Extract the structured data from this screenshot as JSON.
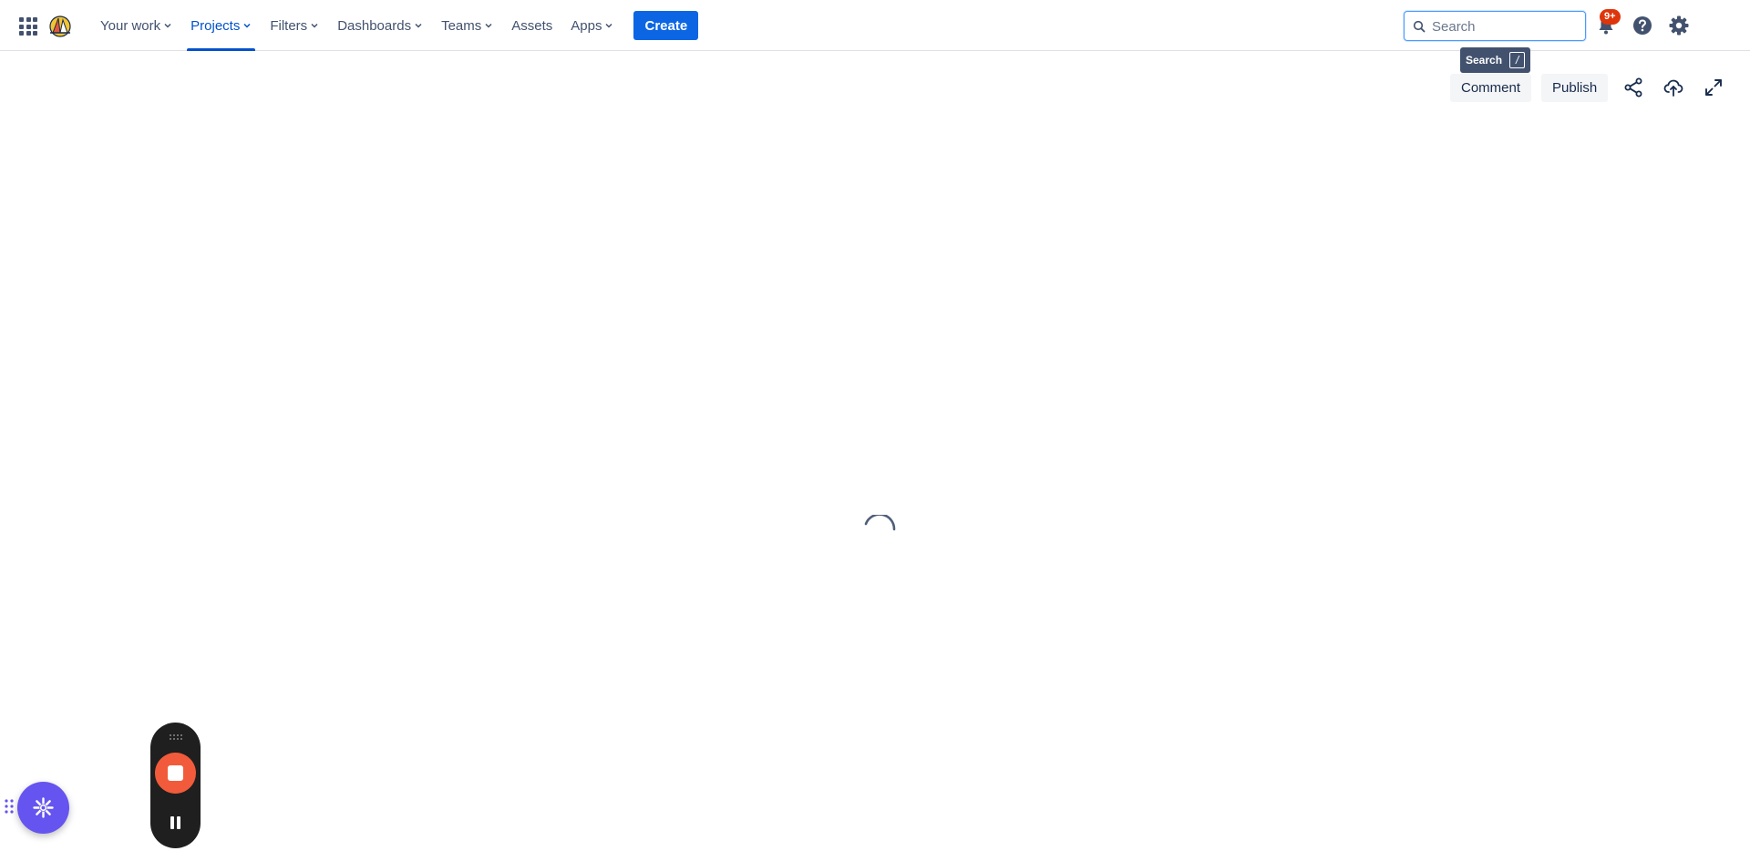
{
  "nav": {
    "items": [
      {
        "label": "Your work",
        "dropdown": true,
        "active": false
      },
      {
        "label": "Projects",
        "dropdown": true,
        "active": true
      },
      {
        "label": "Filters",
        "dropdown": true,
        "active": false
      },
      {
        "label": "Dashboards",
        "dropdown": true,
        "active": false
      },
      {
        "label": "Teams",
        "dropdown": true,
        "active": false
      },
      {
        "label": "Assets",
        "dropdown": false,
        "active": false
      },
      {
        "label": "Apps",
        "dropdown": true,
        "active": false
      }
    ],
    "create_label": "Create",
    "accent_color": "#0052cc"
  },
  "search": {
    "placeholder": "Search",
    "value": "",
    "tooltip_label": "Search",
    "tooltip_shortcut": "/"
  },
  "notifications": {
    "badge": "9+",
    "badge_color": "#de350b"
  },
  "icons": {
    "app_switcher": "grid-icon",
    "logo": "jira-logo-icon",
    "search": "search-icon",
    "notifications": "bell-icon",
    "help": "help-icon",
    "settings": "gear-icon",
    "share": "share-icon",
    "export": "cloud-upload-icon",
    "fullscreen": "expand-icon",
    "assistant": "sparkle-icon"
  },
  "toolbar": {
    "comment_label": "Comment",
    "publish_label": "Publish"
  },
  "recorder": {
    "stop_color": "#f15b3b",
    "state": "recording"
  },
  "assistant": {
    "color": "#6554f0"
  }
}
